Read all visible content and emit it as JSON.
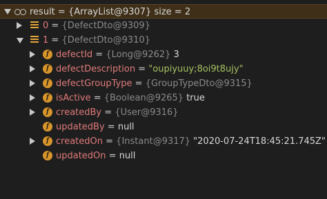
{
  "root": {
    "name": "result",
    "eq": " = ",
    "ref": "{ArrayList@9307}",
    "extra": "  size = 2"
  },
  "items": [
    {
      "name": "0",
      "eq": " = ",
      "ref": "{DefectDto@9309}"
    },
    {
      "name": "1",
      "eq": " = ",
      "ref": "{DefectDto@9310}"
    }
  ],
  "fields": [
    {
      "name": "defectId",
      "eq": " = ",
      "ref": "{Long@9262}",
      "value": " 3"
    },
    {
      "name": "defectDescription",
      "eq": " = ",
      "value": "\"oupiyuuy;8oi9t8ujy\""
    },
    {
      "name": "defectGroupType",
      "eq": " = ",
      "ref": "{GroupTypeDto@9315}"
    },
    {
      "name": "isActive",
      "eq": " = ",
      "ref": "{Boolean@9265}",
      "value": " true"
    },
    {
      "name": "createdBy",
      "eq": " = ",
      "ref": "{User@9316}"
    },
    {
      "name": "updatedBy",
      "eq": " = ",
      "value": "null"
    },
    {
      "name": "createdOn",
      "eq": " = ",
      "ref": "{Instant@9317}",
      "value": " \"2020-07-24T18:45:21.745Z\""
    },
    {
      "name": "updatedOn",
      "eq": " = ",
      "value": "null"
    }
  ],
  "icons": {
    "root": "watch-glasses-icon",
    "item": "list-icon",
    "field": "field-icon",
    "field_glyph": "f"
  },
  "colors": {
    "background": "#1e1e1e",
    "selection": "#3f2f18",
    "field_name": "#e07a7a",
    "reference": "#8a8a8a",
    "string": "#a5c261",
    "field_icon": "#d8952c",
    "list_icon": "#e3a53b"
  }
}
